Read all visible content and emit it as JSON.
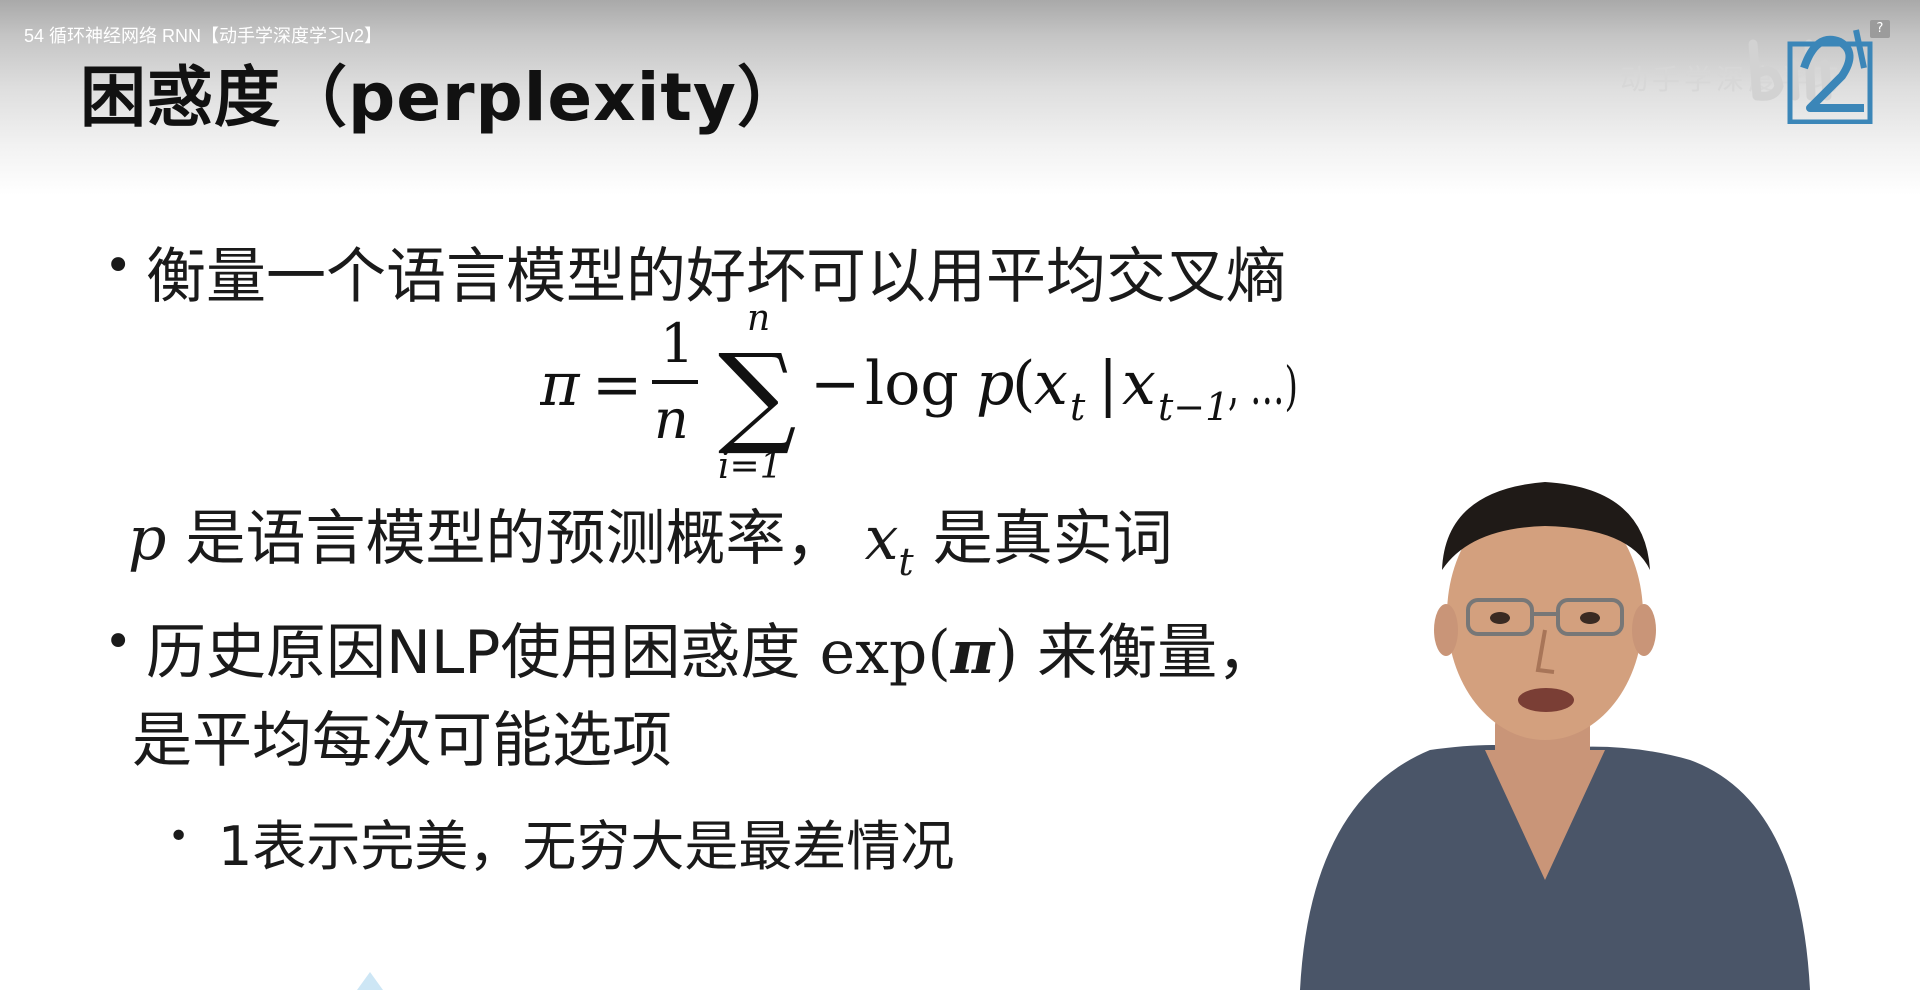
{
  "video": {
    "title": "54 循环神经网络 RNN【动手学深度学习v2】"
  },
  "slide": {
    "title": "困惑度（perplexity）",
    "bullet1": "衡量一个语言模型的好坏可以用平均交叉熵",
    "formula": {
      "lhs": "π",
      "equals": "=",
      "numerator": "1",
      "denominator": "n",
      "sum_top": "n",
      "sum_bottom": "i=1",
      "sum_symbol": "∑",
      "minus": "−",
      "log": "log",
      "p": "p",
      "open": "(",
      "x": "x",
      "sub_t": "t",
      "bar": "|",
      "sub_t1": "t−1",
      "rest": ", …)"
    },
    "line3": {
      "p": "p",
      "text_a": "是语言模型的预测概率，",
      "x": "x",
      "sub": "t",
      "text_b": "是真实词"
    },
    "bullet2": {
      "text_a": "历史原因NLP使用困惑度",
      "exp": "exp(",
      "pi": "π",
      "close": ")",
      "text_b": "来衡量，",
      "line2": "是平均每次可能选项"
    },
    "subbullet": "1表示完美，无穷大是最差情况"
  },
  "player": {
    "help_label": "?",
    "watermark": "动手学深度学习"
  },
  "colors": {
    "text": "#1a1a1a",
    "logo_blue": "#3b86b8",
    "shirt": "#4a5568",
    "skin": "#d3a07e"
  }
}
